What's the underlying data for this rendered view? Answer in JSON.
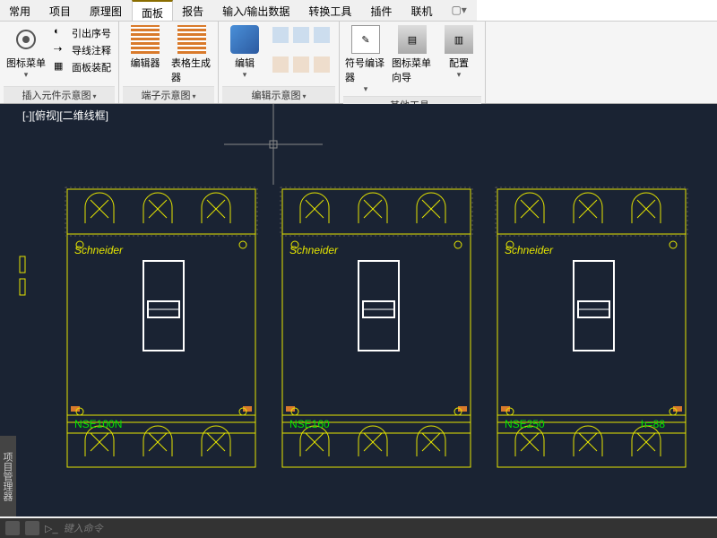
{
  "tabs": [
    "常用",
    "项目",
    "原理图",
    "面板",
    "报告",
    "输入/输出数据",
    "转换工具",
    "插件",
    "联机"
  ],
  "active_tab": "面板",
  "ribbon": {
    "panels": [
      {
        "title": "插入元件示意图",
        "big": {
          "label": "图标菜单",
          "icon": "menu-icon"
        },
        "small": [
          "引出序号",
          "导线注释",
          "面板装配"
        ]
      },
      {
        "title": "端子示意图",
        "bigs": [
          {
            "label": "编辑器",
            "icon": "editor-icon"
          },
          {
            "label": "表格生成器",
            "icon": "table-gen-icon"
          }
        ]
      },
      {
        "title": "编辑示意图",
        "big": {
          "label": "编辑",
          "icon": "edit-icon"
        },
        "grid_icons": 6
      },
      {
        "title": "其他工具",
        "bigs": [
          {
            "label": "符号编译器",
            "icon": "symbol-compiler-icon"
          },
          {
            "label": "图标菜单向导",
            "icon": "menu-wizard-icon"
          },
          {
            "label": "配置",
            "icon": "config-icon"
          }
        ]
      }
    ]
  },
  "canvas": {
    "view_label": "[-][俯视][二维线框]",
    "components": [
      {
        "brand": "Schneider",
        "model": "NSE100N",
        "h": ""
      },
      {
        "brand": "Schneider",
        "model": "NSE160",
        "h": ""
      },
      {
        "brand": "Schneider",
        "model": "NSE250",
        "h": "h=88"
      }
    ]
  },
  "side_panel": "项目管理器",
  "cmd_placeholder": "键入命令"
}
